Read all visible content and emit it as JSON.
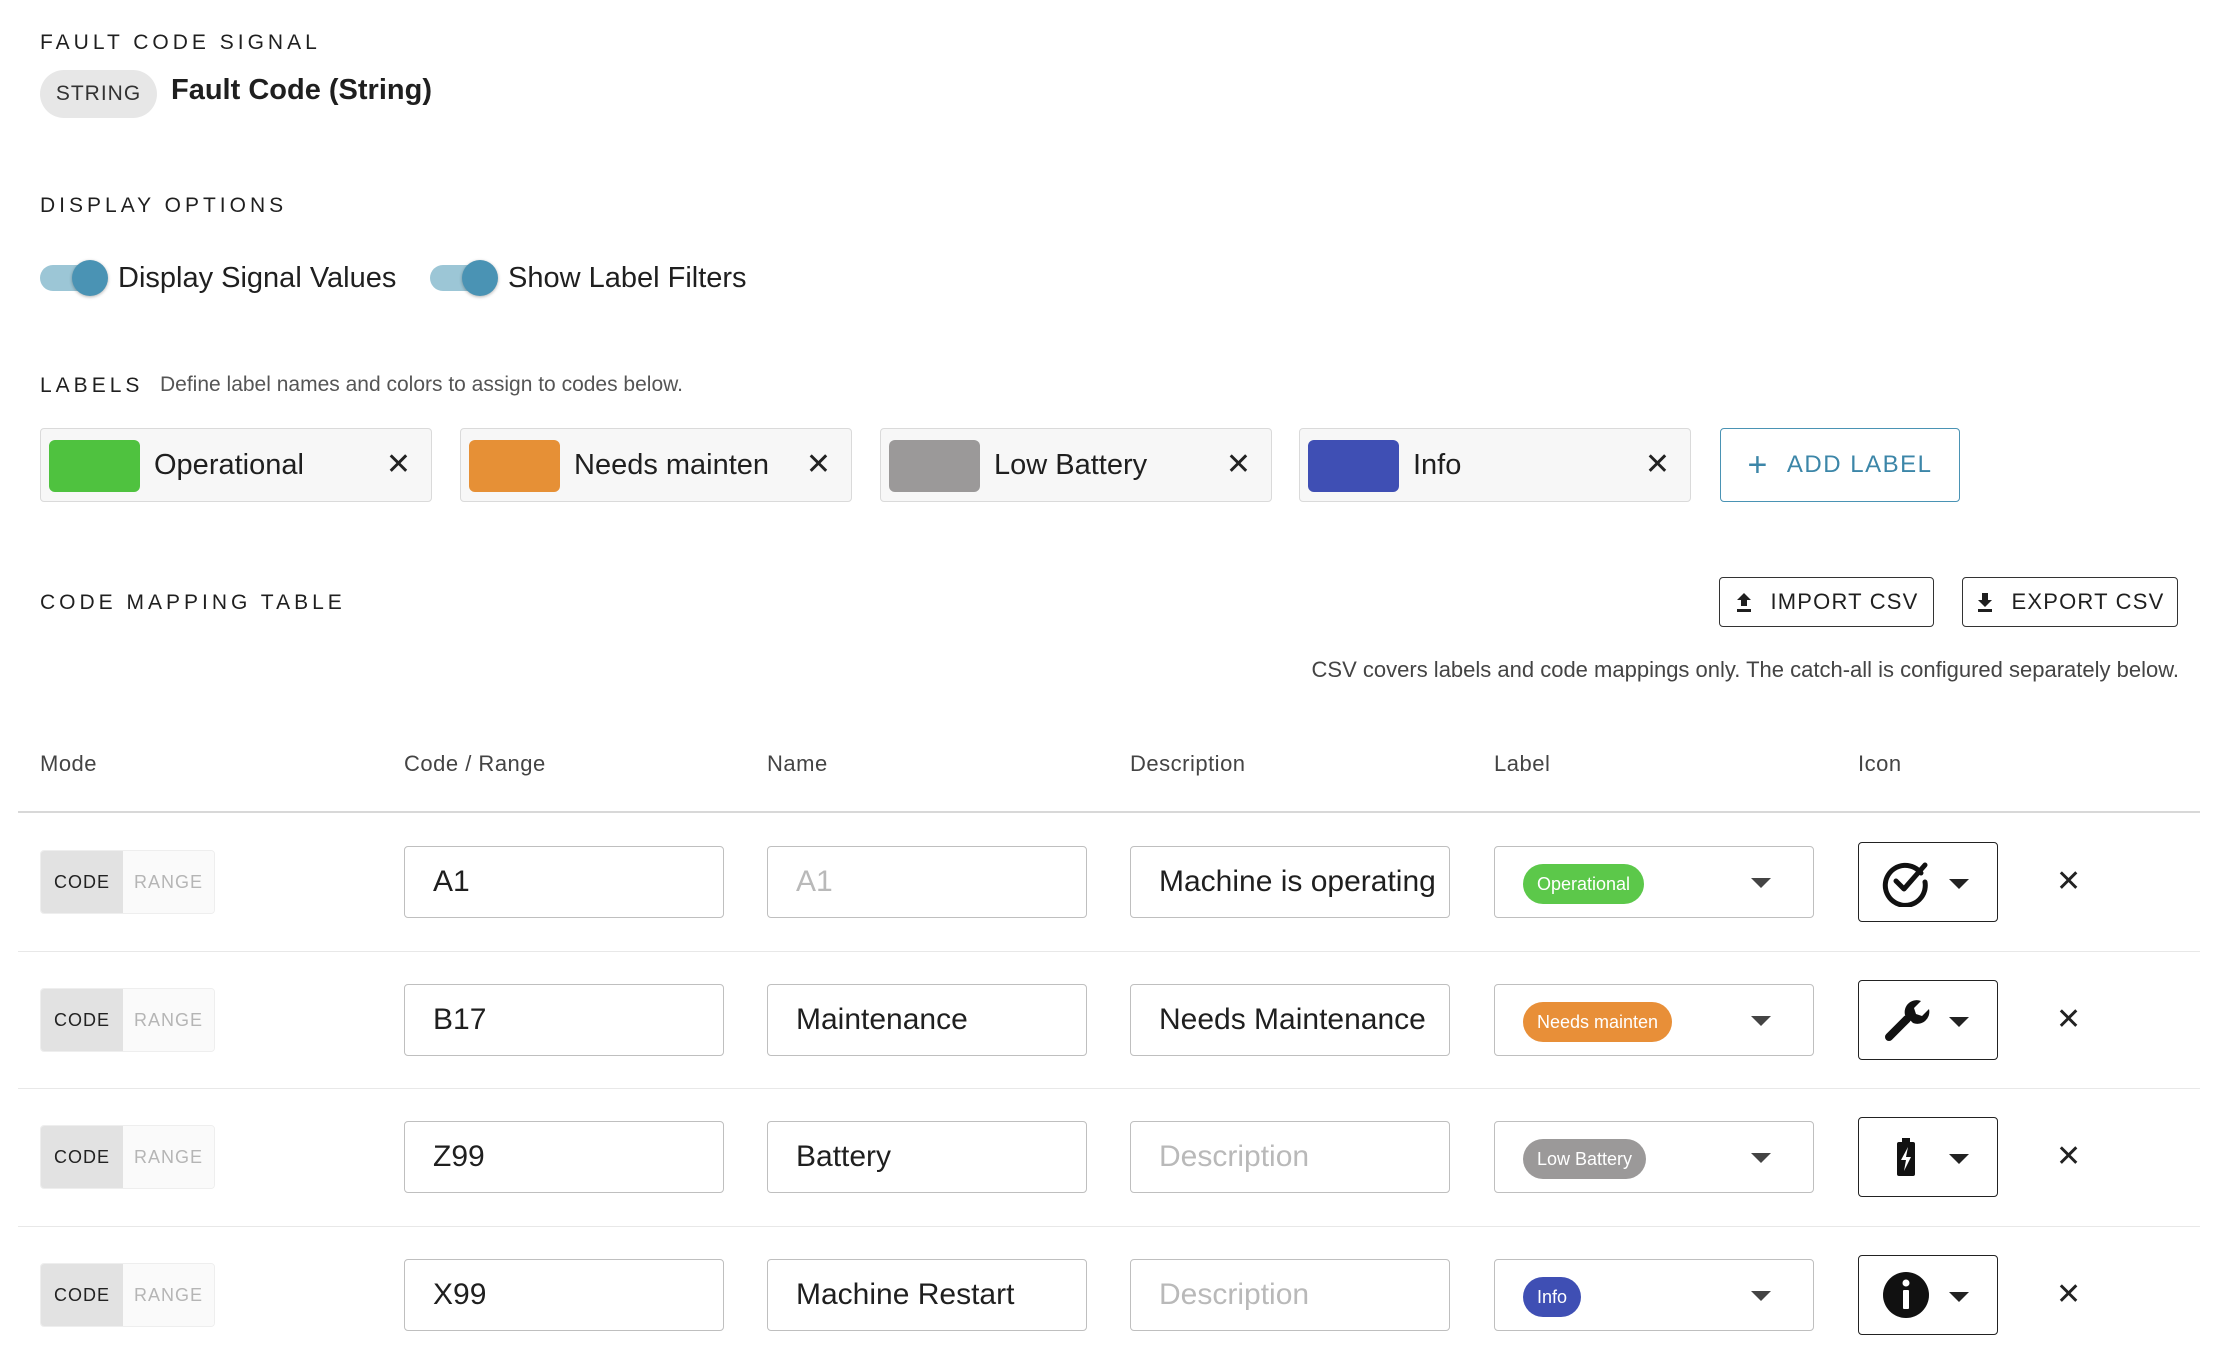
{
  "signal": {
    "section_title": "FAULT CODE SIGNAL",
    "type_badge": "STRING",
    "name": "Fault Code (String)"
  },
  "display_options": {
    "section_title": "DISPLAY OPTIONS",
    "toggles": [
      {
        "label": "Display Signal Values",
        "on": true
      },
      {
        "label": "Show Label Filters",
        "on": true
      }
    ]
  },
  "labels": {
    "section_title": "LABELS",
    "hint": "Define label names and colors to assign to codes below.",
    "items": [
      {
        "name": "Operational",
        "color": "#4fc23f"
      },
      {
        "name": "Needs mainten",
        "color": "#e69036"
      },
      {
        "name": "Low Battery",
        "color": "#9b9999"
      },
      {
        "name": "Info",
        "color": "#3f4fb4"
      }
    ],
    "add_label": "ADD LABEL"
  },
  "mapping": {
    "section_title": "CODE MAPPING TABLE",
    "import_label": "IMPORT CSV",
    "export_label": "EXPORT CSV",
    "csv_note": "CSV covers labels and code mappings only. The catch-all is configured separately below.",
    "columns": [
      "Mode",
      "Code / Range",
      "Name",
      "Description",
      "Label",
      "Icon"
    ],
    "mode_code": "CODE",
    "mode_range": "RANGE",
    "rows": [
      {
        "code": "A1",
        "name": "A1",
        "name_is_placeholder": true,
        "description": "Machine is operating",
        "description_is_placeholder": false,
        "label": "Operational",
        "label_color": "#5cc84a",
        "icon": "check-circle-icon"
      },
      {
        "code": "B17",
        "name": "Maintenance",
        "name_is_placeholder": false,
        "description": "Needs Maintenance",
        "description_is_placeholder": false,
        "label": "Needs mainten",
        "label_color": "#e88f38",
        "icon": "wrench-icon"
      },
      {
        "code": "Z99",
        "name": "Battery",
        "name_is_placeholder": false,
        "description": "Description",
        "description_is_placeholder": true,
        "label": "Low Battery",
        "label_color": "#9b9999",
        "icon": "battery-charging-icon"
      },
      {
        "code": "X99",
        "name": "Machine Restart",
        "name_is_placeholder": false,
        "description": "Description",
        "description_is_placeholder": true,
        "label": "Info",
        "label_color": "#3f4fb4",
        "icon": "info-circle-icon"
      }
    ]
  }
}
